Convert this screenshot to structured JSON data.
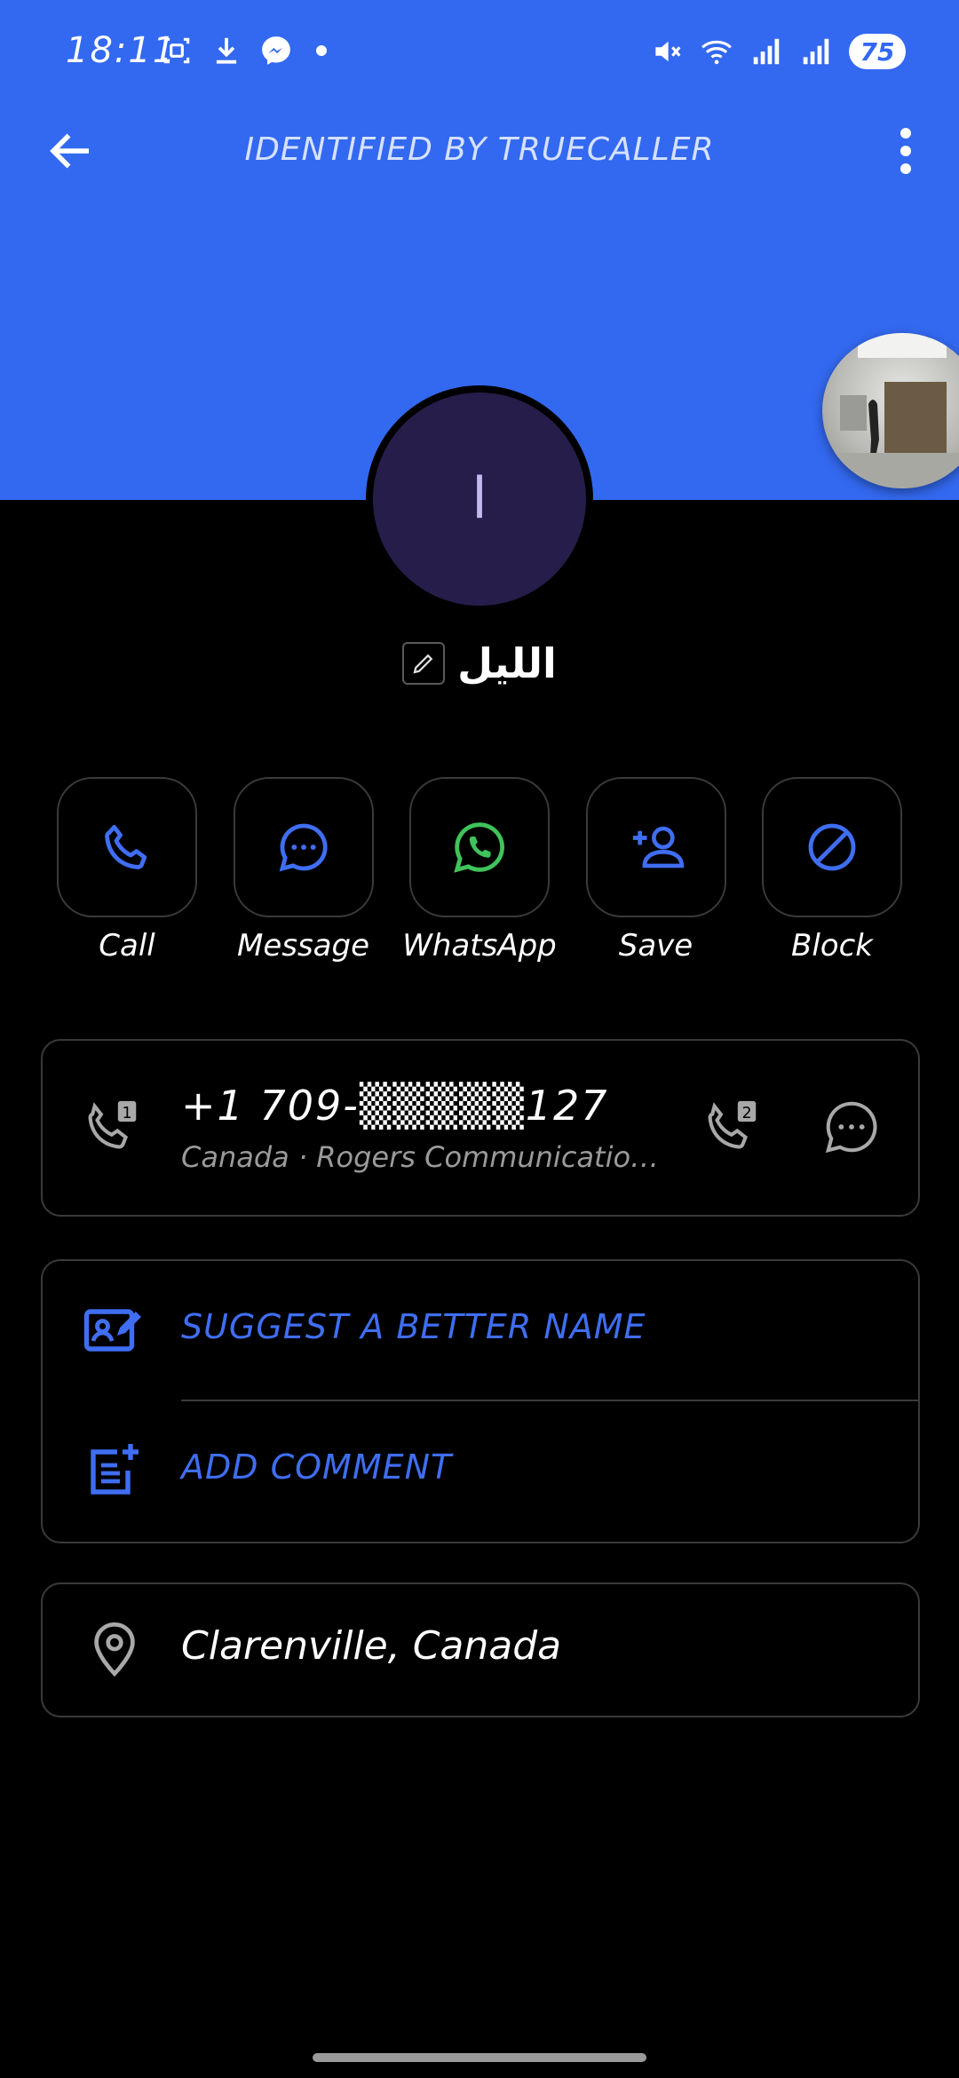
{
  "status_bar": {
    "time": "18:11",
    "battery": "75",
    "left_icons": [
      "screenshot-icon",
      "download-icon",
      "messenger-icon",
      "dot-icon"
    ],
    "right_icons": [
      "mute-icon",
      "wifi-icon",
      "signal-icon",
      "signal-icon"
    ]
  },
  "app_bar": {
    "title": "IDENTIFIED BY TRUECALLER",
    "back_icon": "back-arrow-icon",
    "menu_icon": "more-vertical-icon"
  },
  "contact": {
    "avatar_letter": "ا",
    "name": "الليل",
    "edit_icon": "pencil-icon"
  },
  "actions": [
    {
      "label": "Call",
      "icon": "phone-icon"
    },
    {
      "label": "Message",
      "icon": "message-icon"
    },
    {
      "label": "WhatsApp",
      "icon": "whatsapp-icon"
    },
    {
      "label": "Save",
      "icon": "add-person-icon"
    },
    {
      "label": "Block",
      "icon": "block-icon"
    }
  ],
  "phone_card": {
    "number": "+1 709-▒▒▒▒▒127",
    "carrier": "Canada · Rogers Communicatio…"
  },
  "suggest_card": {
    "suggest_label": "SUGGEST A BETTER NAME",
    "comment_label": "ADD COMMENT"
  },
  "location": {
    "label": "Clarenville, Canada"
  },
  "colors": {
    "header_blue": "#3369f0",
    "accent_blue": "#3f6ef2",
    "whatsapp_green": "#3fc35a",
    "avatar_bg": "#261d4a"
  }
}
